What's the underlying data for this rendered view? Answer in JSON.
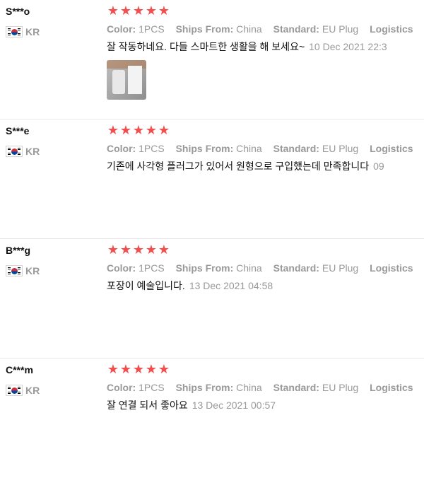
{
  "labels": {
    "color": "Color:",
    "ships_from": "Ships From:",
    "standard": "Standard:",
    "logistics": "Logistics"
  },
  "reviews": [
    {
      "user": "S***o",
      "country": "KR",
      "rating": 5,
      "color": "1PCS",
      "ships_from": "China",
      "standard": "EU Plug",
      "feedback": "잘 작동하네요. 다들 스마트한 생활을 해 보세요~",
      "date": "10 Dec 2021 22:3",
      "has_photo": true
    },
    {
      "user": "S***e",
      "country": "KR",
      "rating": 5,
      "color": "1PCS",
      "ships_from": "China",
      "standard": "EU Plug",
      "feedback": "기존에 사각형 플러그가 있어서 원형으로 구입했는데 만족합니다",
      "date": "09",
      "has_photo": false
    },
    {
      "user": "B***g",
      "country": "KR",
      "rating": 5,
      "color": "1PCS",
      "ships_from": "China",
      "standard": "EU Plug",
      "feedback": "포장이 예술입니다.",
      "date": "13 Dec 2021 04:58",
      "has_photo": false
    },
    {
      "user": "C***m",
      "country": "KR",
      "rating": 5,
      "color": "1PCS",
      "ships_from": "China",
      "standard": "EU Plug",
      "feedback": "잘 연결 되서 좋아요",
      "date": "13 Dec 2021 00:57",
      "has_photo": false
    }
  ],
  "star_color": "#f44d4d",
  "flag_icon": "south-korea-flag-icon",
  "star_icon": "star-icon"
}
